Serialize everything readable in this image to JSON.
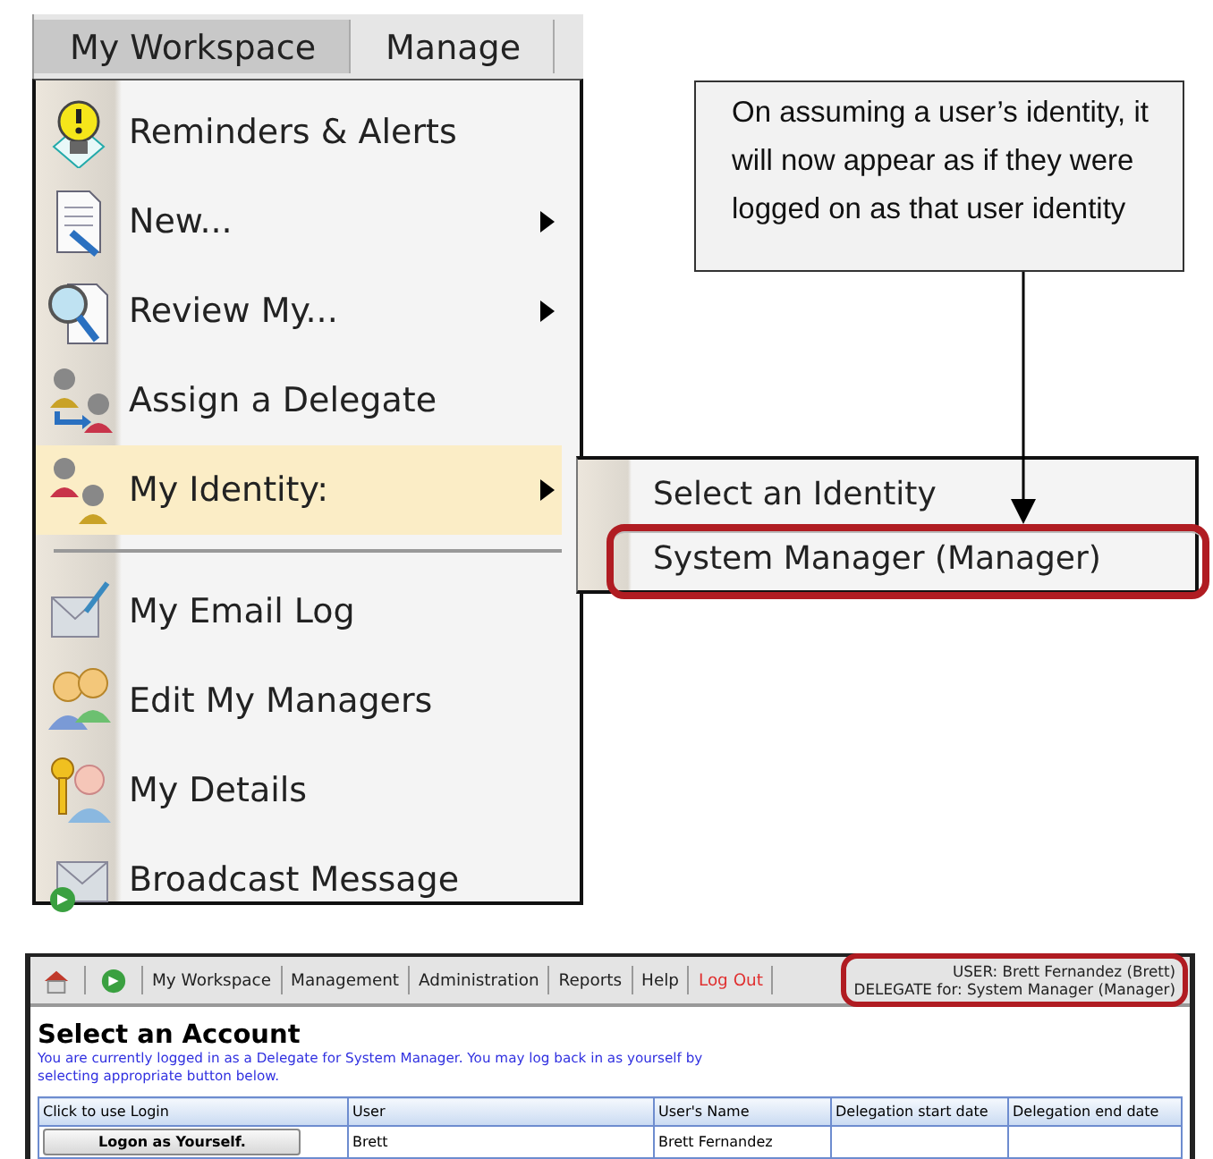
{
  "menu_screenshot": {
    "menu_bar": [
      {
        "label": "My Workspace",
        "selected": true
      },
      {
        "label": "Manage",
        "selected": false
      }
    ],
    "menu_items": [
      {
        "kind": "bulb",
        "label": "Reminders & Alerts",
        "submenu": false,
        "highlighted": false
      },
      {
        "kind": "document",
        "label": "New...",
        "submenu": true,
        "highlighted": false
      },
      {
        "kind": "magnifier",
        "label": "Review My...",
        "submenu": true,
        "highlighted": false
      },
      {
        "kind": "delegate",
        "label": "Assign a Delegate",
        "submenu": false,
        "highlighted": false
      },
      {
        "kind": "identity",
        "label": "My Identity:",
        "submenu": true,
        "highlighted": true
      },
      {
        "kind": "separator"
      },
      {
        "kind": "email",
        "label": "My Email Log",
        "submenu": false,
        "highlighted": false
      },
      {
        "kind": "managers",
        "label": "Edit My Managers",
        "submenu": false,
        "highlighted": false
      },
      {
        "kind": "details",
        "label": "My Details",
        "submenu": false,
        "highlighted": false
      },
      {
        "kind": "broadcast",
        "label": "Broadcast Message",
        "submenu": false,
        "highlighted": false
      }
    ],
    "submenu": [
      {
        "label": "Select an Identity",
        "annotated": false
      },
      {
        "label": "System Manager (Manager)",
        "annotated": true
      }
    ],
    "callout": {
      "text": "On assuming a user’s identity, it will now appear as if they were logged on as that user identity"
    }
  },
  "app_screenshot": {
    "nav": [
      {
        "kind": "link",
        "label": "My Workspace"
      },
      {
        "kind": "link",
        "label": "Management"
      },
      {
        "kind": "link",
        "label": "Administration"
      },
      {
        "kind": "link",
        "label": "Reports"
      },
      {
        "kind": "link",
        "label": "Help"
      },
      {
        "kind": "logout",
        "label": "Log Out"
      }
    ],
    "user_info": {
      "user": "USER: Brett Fernandez (Brett)",
      "delegate": "DELEGATE for: System Manager (Manager)",
      "annotated": true
    },
    "title": "Select an Account",
    "intro": "You are currently logged in as a Delegate for System Manager. You may log back in as yourself by selecting appropriate button below.",
    "table": {
      "columns": [
        "Click to use Login",
        "User",
        "User's Name",
        "Delegation start date",
        "Delegation end date"
      ],
      "rows": [
        {
          "button": "Logon as Yourself.",
          "user": "Brett",
          "users_name": "Brett Fernandez"
        }
      ]
    }
  }
}
